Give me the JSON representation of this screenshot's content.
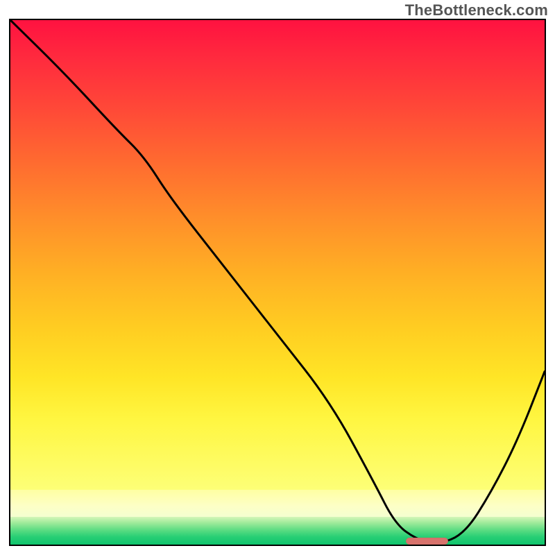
{
  "watermark": "TheBottleneck.com",
  "chart_data": {
    "type": "line",
    "title": "",
    "xlabel": "",
    "ylabel": "",
    "xlim": [
      0,
      100
    ],
    "ylim": [
      0,
      100
    ],
    "grid": false,
    "legend": false,
    "series": [
      {
        "name": "bottleneck-curve",
        "x": [
          0,
          10,
          20,
          25,
          30,
          40,
          50,
          60,
          68,
          72,
          76,
          80,
          85,
          90,
          95,
          100
        ],
        "y": [
          100,
          90,
          79,
          74,
          66,
          53,
          40,
          27,
          12,
          4,
          1,
          0,
          2,
          10,
          20,
          33
        ]
      }
    ],
    "background_gradient": {
      "stops": [
        {
          "pos": 0.0,
          "color": "#ff1240"
        },
        {
          "pos": 0.3,
          "color": "#ff6a30"
        },
        {
          "pos": 0.6,
          "color": "#ffce22"
        },
        {
          "pos": 0.85,
          "color": "#fff641"
        },
        {
          "pos": 0.92,
          "color": "#fdffb0"
        },
        {
          "pos": 0.96,
          "color": "#9eea9a"
        },
        {
          "pos": 1.0,
          "color": "#0fc46c"
        }
      ]
    },
    "marker": {
      "name": "optimal-range-pill",
      "color": "#d8736d",
      "x_start": 74,
      "x_end": 82,
      "y": 0
    }
  }
}
